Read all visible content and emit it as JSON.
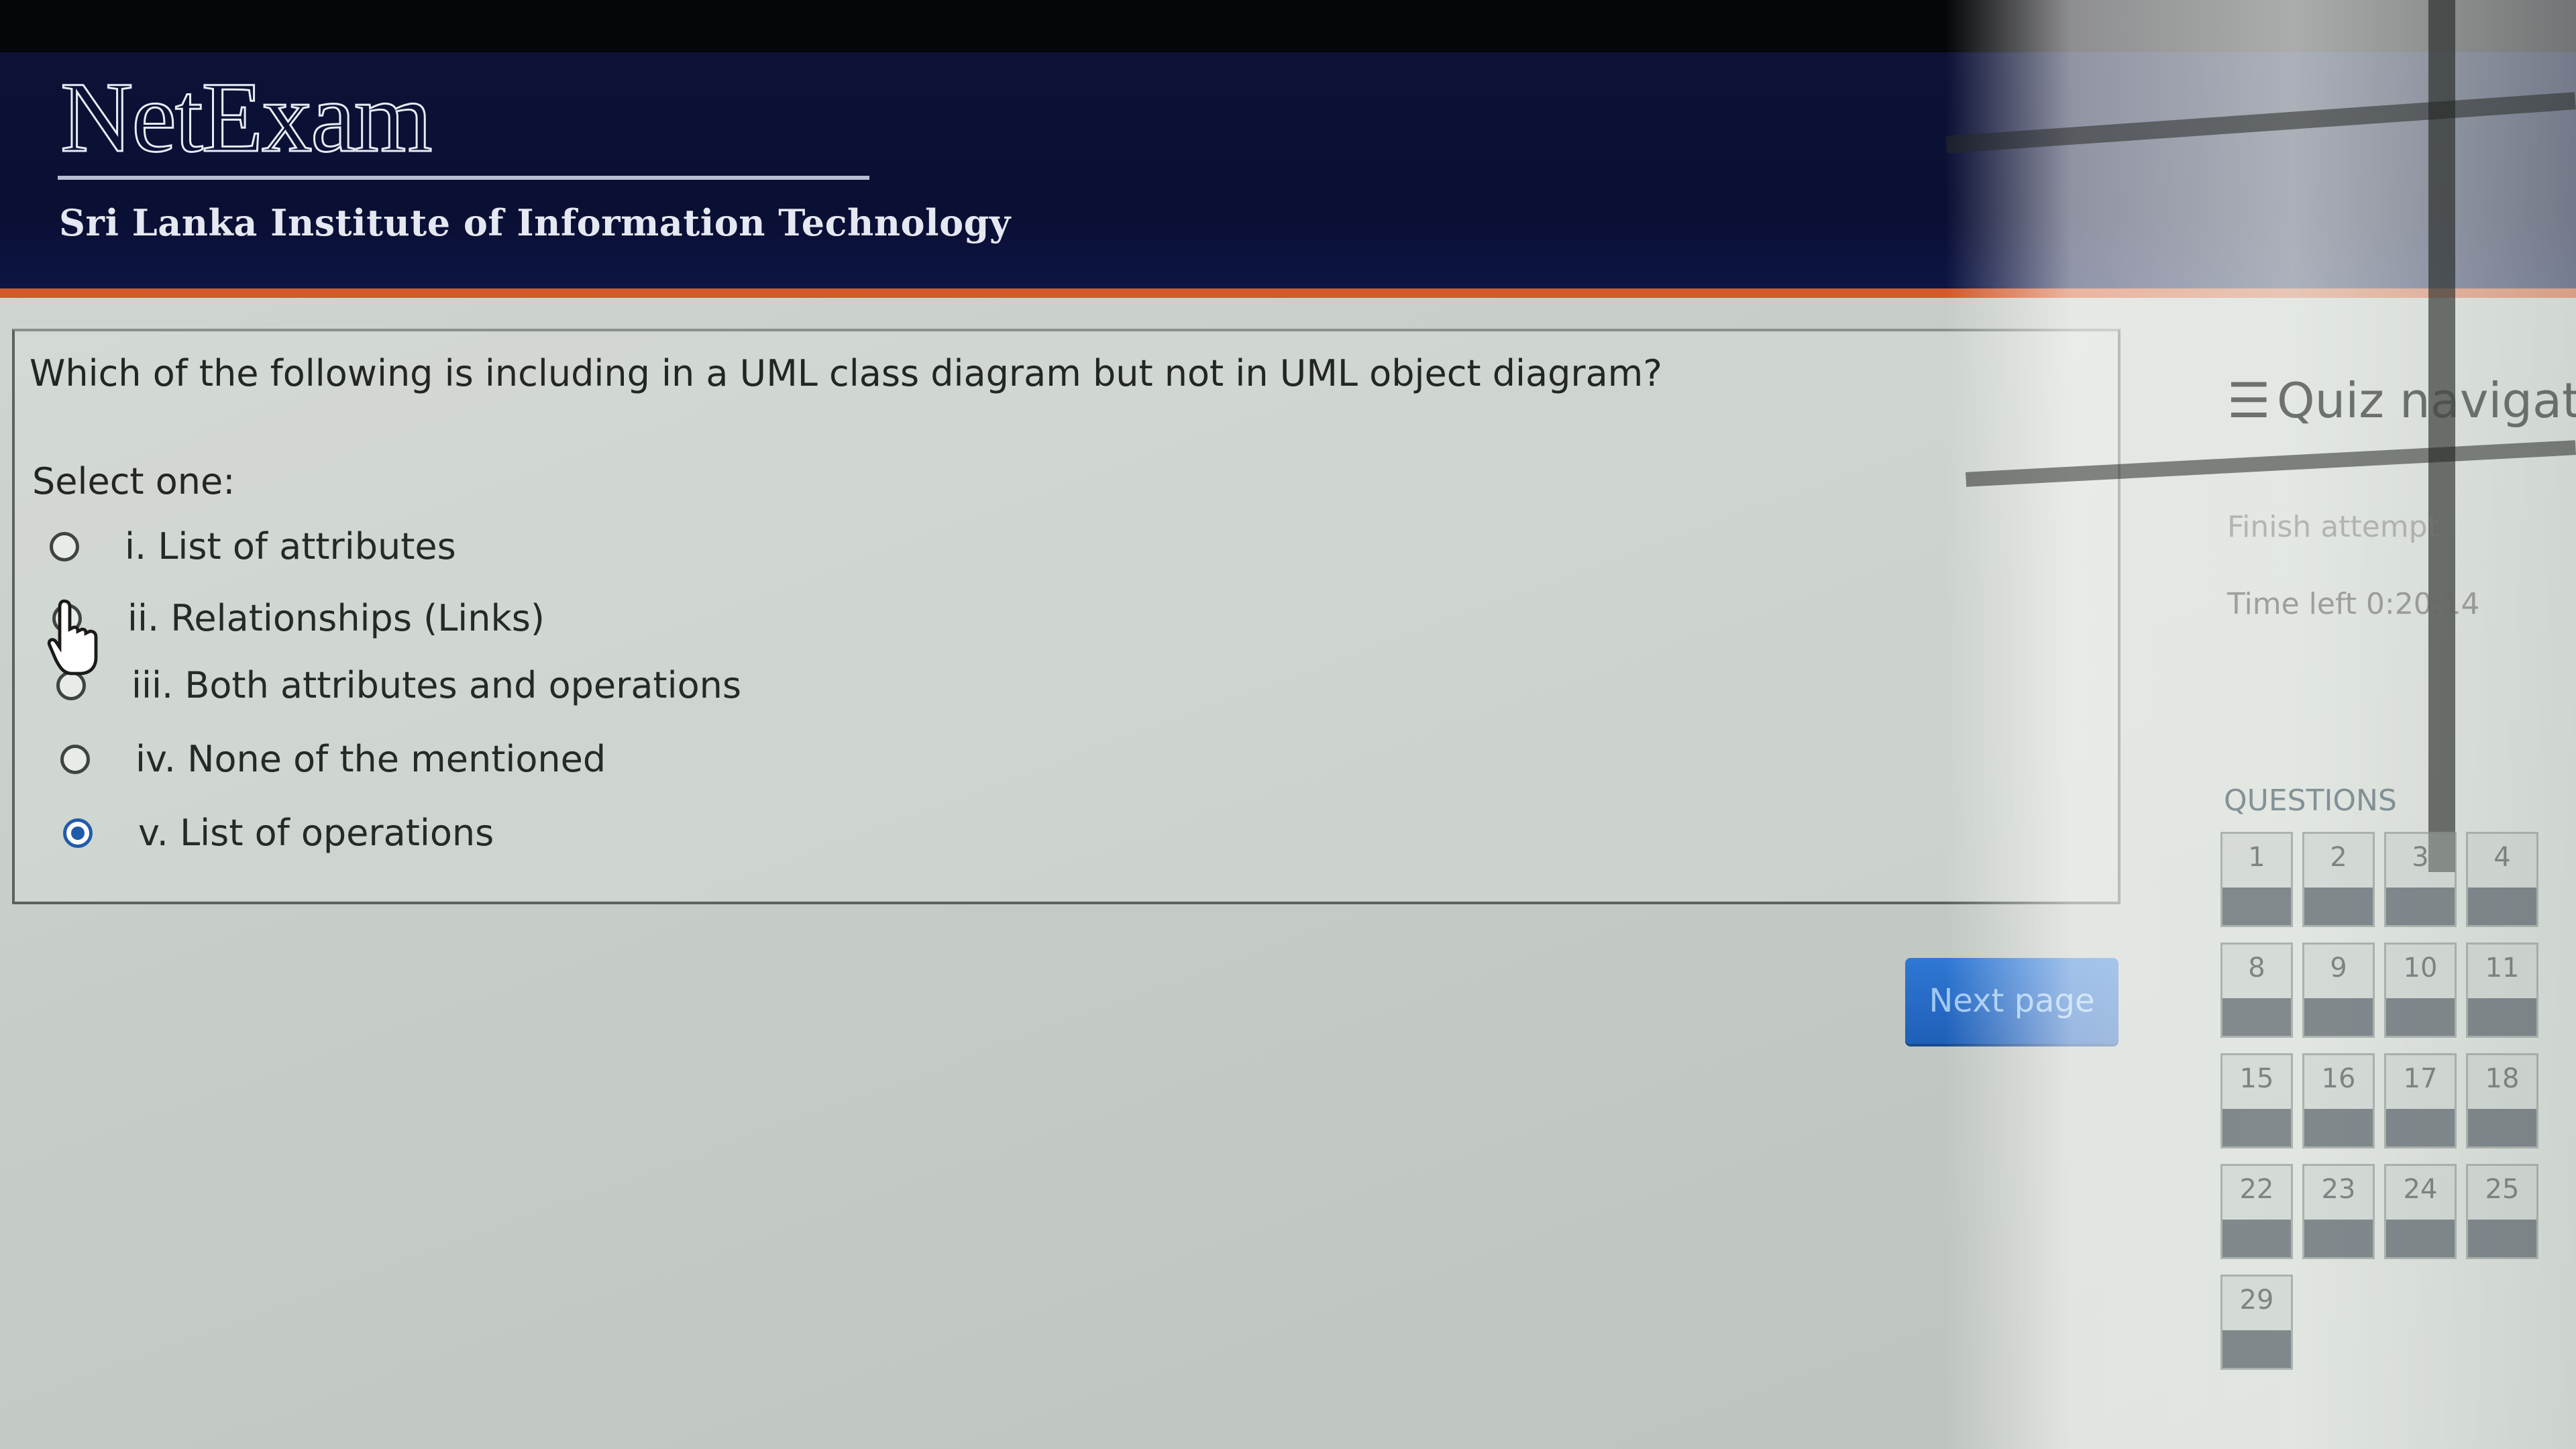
{
  "header": {
    "logo": "NetExam",
    "institution": "Sri Lanka Institute of Information Technology"
  },
  "question": {
    "text": "Which of the following is including in a UML class diagram but not in UML object diagram?",
    "select_label": "Select one:",
    "options": [
      {
        "label": "i. List of attributes",
        "selected": false
      },
      {
        "label": "ii. Relationships (Links)",
        "selected": false
      },
      {
        "label": "iii. Both attributes and operations",
        "selected": false
      },
      {
        "label": "iv. None of the mentioned",
        "selected": false
      },
      {
        "label": "v. List of operations",
        "selected": true
      }
    ]
  },
  "next_button": {
    "label": "Next page"
  },
  "quiz_nav": {
    "title": "Quiz navigation",
    "finish": "Finish attempt",
    "time_left": "Time left 0:20:14",
    "questions_label": "QUESTIONS",
    "questions": [
      "1",
      "2",
      "3",
      "4",
      "8",
      "9",
      "10",
      "11",
      "15",
      "16",
      "17",
      "18",
      "22",
      "23",
      "24",
      "25",
      "29"
    ]
  },
  "colors": {
    "header_bg": "#0a0f34",
    "accent_stripe": "#d25a2c",
    "button_blue": "#1f5fb8",
    "radio_selected": "#1f5ca8"
  }
}
